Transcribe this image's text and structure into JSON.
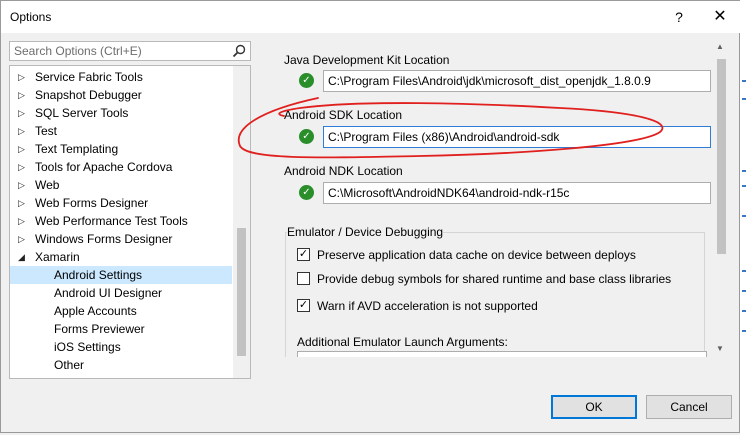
{
  "window": {
    "title": "Options",
    "help_glyph": "?",
    "close_glyph": "✕"
  },
  "search": {
    "placeholder": "Search Options (Ctrl+E)",
    "icon": "magnifier-icon"
  },
  "tree": {
    "items": [
      {
        "label": "Service Fabric Tools",
        "state": "collapsed"
      },
      {
        "label": "Snapshot Debugger",
        "state": "collapsed"
      },
      {
        "label": "SQL Server Tools",
        "state": "collapsed"
      },
      {
        "label": "Test",
        "state": "collapsed"
      },
      {
        "label": "Text Templating",
        "state": "collapsed"
      },
      {
        "label": "Tools for Apache Cordova",
        "state": "collapsed"
      },
      {
        "label": "Web",
        "state": "collapsed"
      },
      {
        "label": "Web Forms Designer",
        "state": "collapsed"
      },
      {
        "label": "Web Performance Test Tools",
        "state": "collapsed"
      },
      {
        "label": "Windows Forms Designer",
        "state": "collapsed"
      },
      {
        "label": "Xamarin",
        "state": "expanded"
      },
      {
        "label": "Android Settings",
        "state": "child-selected"
      },
      {
        "label": "Android UI Designer",
        "state": "child"
      },
      {
        "label": "Apple Accounts",
        "state": "child"
      },
      {
        "label": "Forms Previewer",
        "state": "child"
      },
      {
        "label": "iOS Settings",
        "state": "child"
      },
      {
        "label": "Other",
        "state": "child"
      }
    ]
  },
  "settings": {
    "jdk": {
      "label": "Java Development Kit Location",
      "value": "C:\\Program Files\\Android\\jdk\\microsoft_dist_openjdk_1.8.0.9"
    },
    "sdk": {
      "label": "Android SDK Location",
      "value": "C:\\Program Files (x86)\\Android\\android-sdk"
    },
    "ndk": {
      "label": "Android NDK Location",
      "value": "C:\\Microsoft\\AndroidNDK64\\android-ndk-r15c"
    },
    "status_icon": "checkmark-icon",
    "status_color": "#2a8e2a"
  },
  "emulator": {
    "group_title": "Emulator / Device Debugging",
    "options": [
      {
        "label": "Preserve application data cache on device between deploys",
        "checked": true
      },
      {
        "label": "Provide debug symbols for shared runtime and base class libraries",
        "checked": false
      },
      {
        "label": "Warn if AVD acceleration is not supported",
        "checked": true
      }
    ],
    "args_label": "Additional Emulator Launch Arguments:"
  },
  "buttons": {
    "ok": "OK",
    "cancel": "Cancel"
  },
  "colors": {
    "selection": "#cce8ff",
    "accent": "#0078d7",
    "annotation": "#e0201e"
  }
}
